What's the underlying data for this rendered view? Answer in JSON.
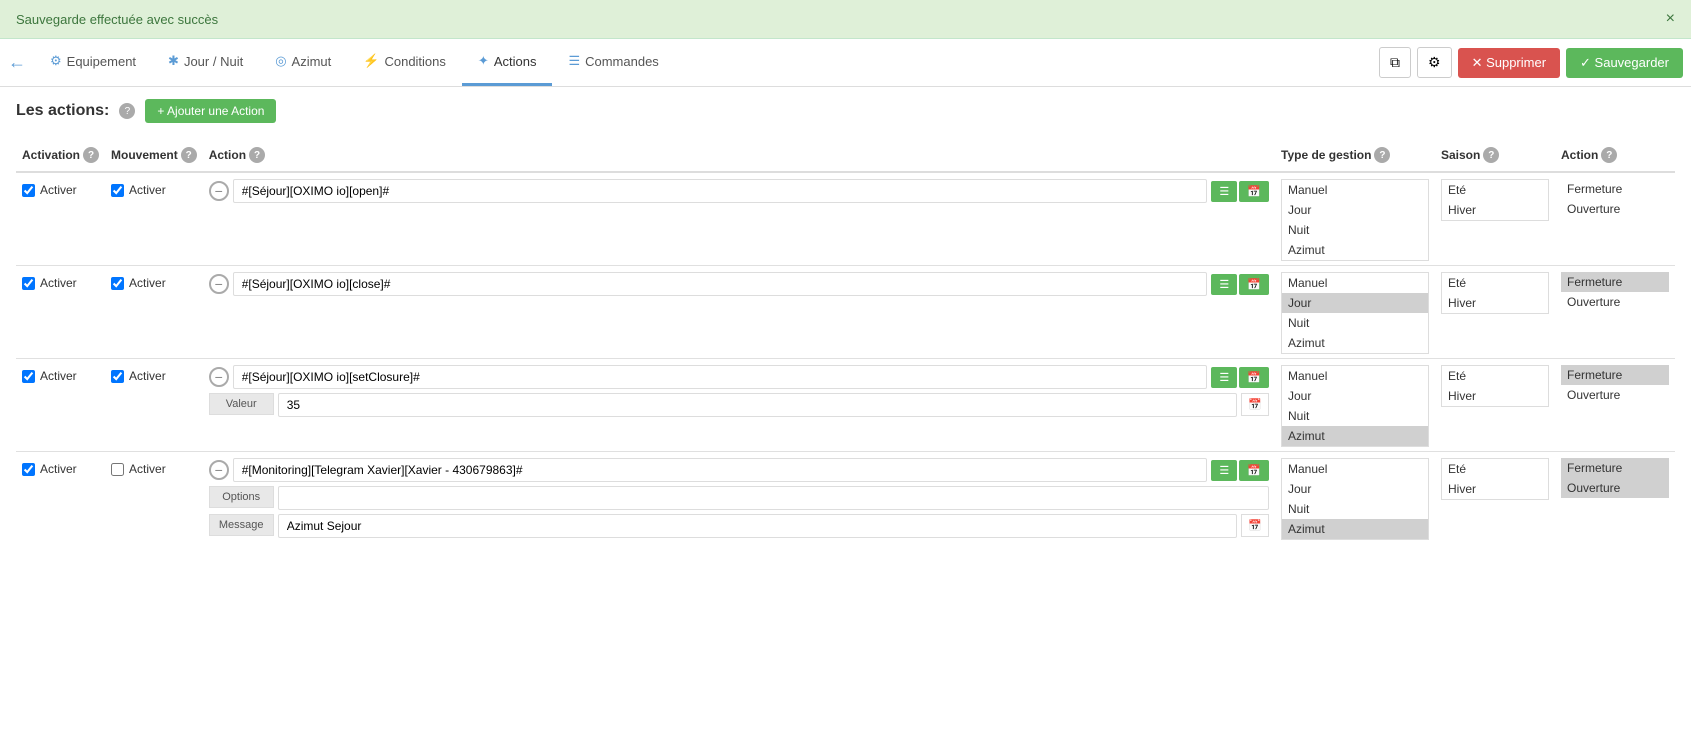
{
  "success_bar": {
    "message": "Sauvegarde effectuée avec succès",
    "close": "×"
  },
  "nav": {
    "back_icon": "←",
    "tabs": [
      {
        "id": "equipement",
        "label": "Equipement",
        "icon": "⚙",
        "active": false
      },
      {
        "id": "jour-nuit",
        "label": "Jour / Nuit",
        "icon": "✱",
        "active": false
      },
      {
        "id": "azimut",
        "label": "Azimut",
        "icon": "◎",
        "active": false
      },
      {
        "id": "conditions",
        "label": "Conditions",
        "icon": "⚡",
        "active": false
      },
      {
        "id": "actions",
        "label": "Actions",
        "icon": "✦",
        "active": true
      },
      {
        "id": "commandes",
        "label": "Commandes",
        "icon": "☰",
        "active": false
      }
    ],
    "btn_copy": "⧉",
    "btn_settings": "⚙",
    "btn_delete": "✕ Supprimer",
    "btn_save": "✓ Sauvegarder"
  },
  "page": {
    "title": "Les actions:",
    "add_button": "+ Ajouter une Action"
  },
  "table": {
    "headers": {
      "activation": "Activation",
      "mouvement": "Mouvement",
      "action": "Action",
      "type_de_gestion": "Type de gestion",
      "saison": "Saison",
      "action_col": "Action"
    },
    "rows": [
      {
        "activation_checked": true,
        "activation_label": "Activer",
        "mouvement_checked": true,
        "mouvement_label": "Activer",
        "action_text": "#[Séjour][OXIMO io][open]#",
        "type_items": [
          "Manuel",
          "Jour",
          "Nuit",
          "Azimut"
        ],
        "type_selected": [],
        "saison_items": [
          "Eté",
          "Hiver"
        ],
        "saison_selected": [],
        "action_items": [
          "Fermeture",
          "Ouverture"
        ],
        "action_selected": [],
        "sub_rows": []
      },
      {
        "activation_checked": true,
        "activation_label": "Activer",
        "mouvement_checked": true,
        "mouvement_label": "Activer",
        "action_text": "#[Séjour][OXIMO io][close]#",
        "type_items": [
          "Manuel",
          "Jour",
          "Nuit",
          "Azimut"
        ],
        "type_selected": [
          "Jour"
        ],
        "saison_items": [
          "Eté",
          "Hiver"
        ],
        "saison_selected": [],
        "action_items": [
          "Fermeture",
          "Ouverture"
        ],
        "action_selected": [
          "Fermeture"
        ],
        "sub_rows": []
      },
      {
        "activation_checked": true,
        "activation_label": "Activer",
        "mouvement_checked": true,
        "mouvement_label": "Activer",
        "action_text": "#[Séjour][OXIMO io][setClosure]#",
        "type_items": [
          "Manuel",
          "Jour",
          "Nuit",
          "Azimut"
        ],
        "type_selected": [
          "Azimut"
        ],
        "saison_items": [
          "Eté",
          "Hiver"
        ],
        "saison_selected": [],
        "action_items": [
          "Fermeture",
          "Ouverture"
        ],
        "action_selected": [
          "Fermeture"
        ],
        "sub_rows": [
          {
            "label": "Valeur",
            "value": "35",
            "has_calendar": true
          }
        ]
      },
      {
        "activation_checked": true,
        "activation_label": "Activer",
        "mouvement_checked": false,
        "mouvement_label": "Activer",
        "action_text": "#[Monitoring][Telegram Xavier][Xavier - 430679863]#",
        "type_items": [
          "Manuel",
          "Jour",
          "Nuit",
          "Azimut"
        ],
        "type_selected": [
          "Azimut"
        ],
        "saison_items": [
          "Eté",
          "Hiver"
        ],
        "saison_selected": [],
        "action_items": [
          "Fermeture",
          "Ouverture"
        ],
        "action_selected": [
          "Fermeture",
          "Ouverture"
        ],
        "sub_rows": [
          {
            "label": "Options",
            "value": "",
            "has_calendar": false
          },
          {
            "label": "Message",
            "value": "Azimut Sejour",
            "has_calendar": true
          }
        ]
      }
    ]
  }
}
